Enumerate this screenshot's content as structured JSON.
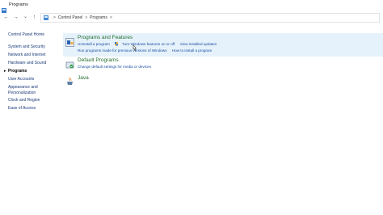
{
  "window": {
    "title": "Programs"
  },
  "address": {
    "crumbs": [
      "Control Panel",
      "Programs"
    ],
    "separator": ">"
  },
  "nav": {
    "back": "←",
    "forward": "→",
    "recent": "⌄",
    "up": "↑"
  },
  "sidebar": {
    "home": "Control Panel Home",
    "items": [
      {
        "label": "System and Security",
        "current": false
      },
      {
        "label": "Network and Internet",
        "current": false
      },
      {
        "label": "Hardware and Sound",
        "current": false
      },
      {
        "label": "Programs",
        "current": true
      },
      {
        "label": "User Accounts",
        "current": false
      },
      {
        "label": "Appearance and",
        "current": false
      },
      {
        "label": "Personalization",
        "current": false
      },
      {
        "label": "Clock and Region",
        "current": false
      },
      {
        "label": "Ease of Access",
        "current": false
      }
    ]
  },
  "categories": [
    {
      "title": "Programs and Features",
      "links": [
        "Uninstall a program",
        "Turn Windows features on or off",
        "View installed updates"
      ],
      "links2": [
        "Run programs made for previous versions of Windows",
        "How to install a program"
      ],
      "highlighted": true
    },
    {
      "title": "Default Programs",
      "links": [
        "Change default settings for media or devices"
      ],
      "highlighted": false
    },
    {
      "title": "Java",
      "links": [],
      "highlighted": false
    }
  ],
  "colors": {
    "link": "#1a4fa0",
    "category_title": "#1f6e2e",
    "highlight": "#e6f2fb"
  }
}
